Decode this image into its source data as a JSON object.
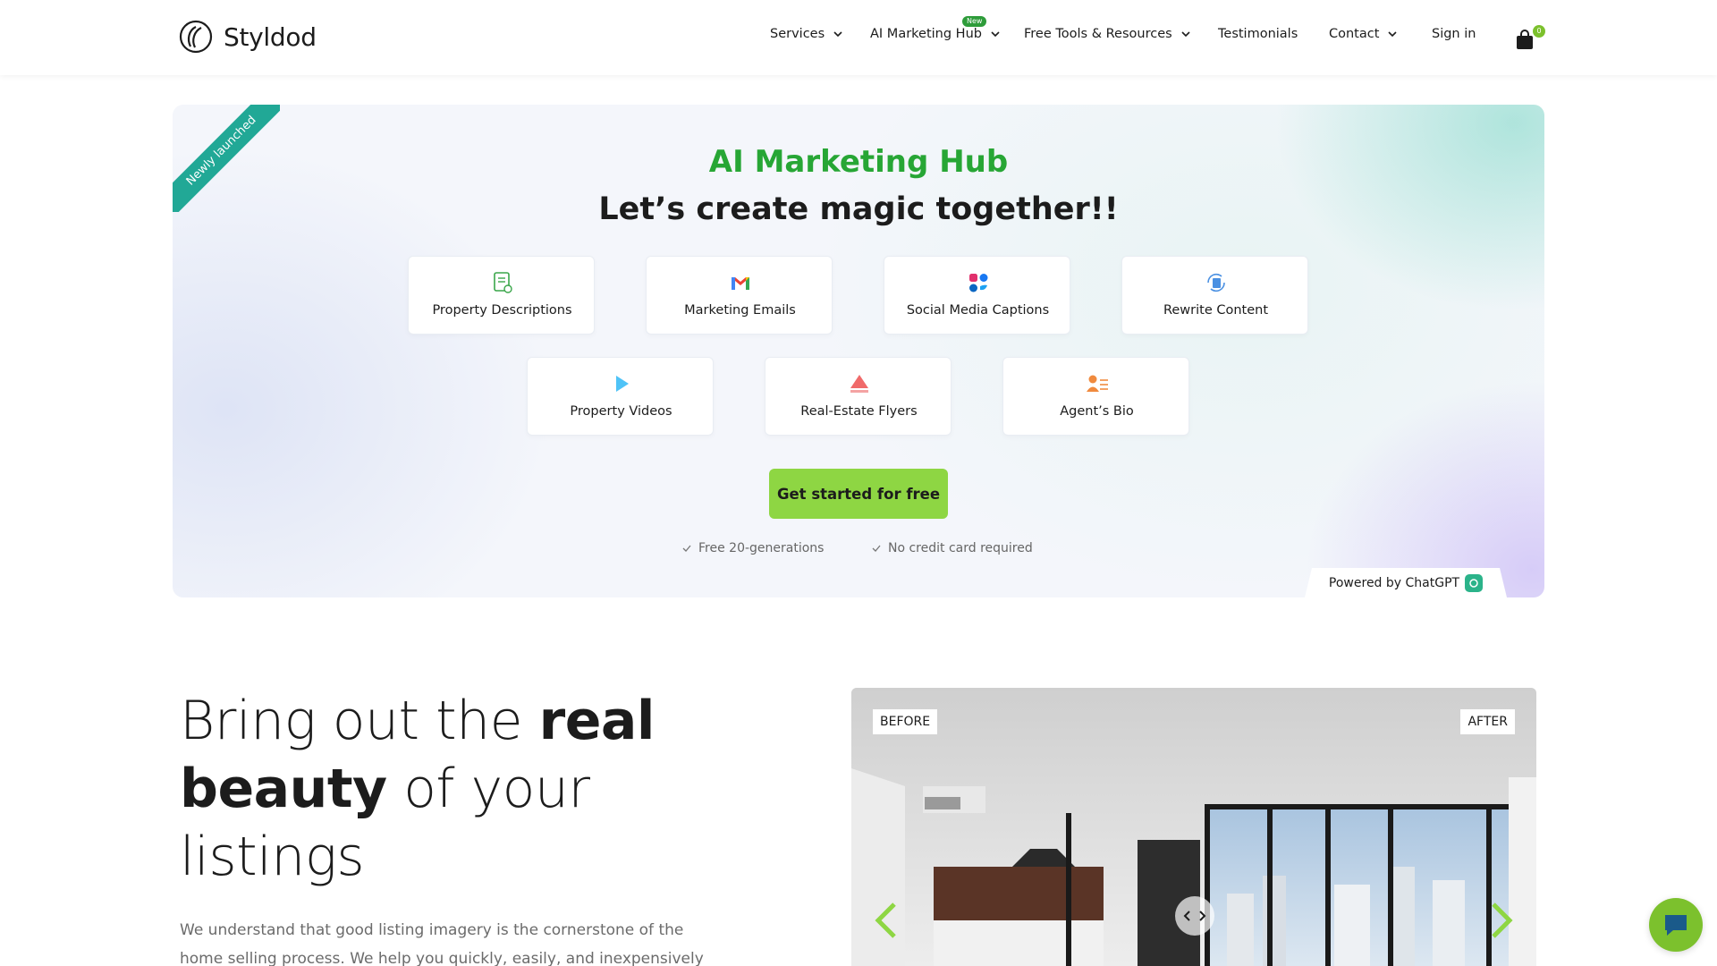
{
  "brand": {
    "name": "Styldod",
    "accent": "#7cc12d",
    "hub_green": "#27a635"
  },
  "nav": {
    "items": [
      {
        "label": "Services",
        "has_dropdown": true
      },
      {
        "label": "AI Marketing Hub",
        "has_dropdown": true,
        "badge": "New"
      },
      {
        "label": "Free Tools & Resources",
        "has_dropdown": true
      },
      {
        "label": "Testimonials",
        "has_dropdown": false
      },
      {
        "label": "Contact",
        "has_dropdown": true
      },
      {
        "label": "Sign in",
        "has_dropdown": false
      }
    ],
    "cart_count": "0"
  },
  "hero": {
    "ribbon": "Newly launched",
    "title": "AI Marketing Hub",
    "subtitle": "Let’s create magic together!!",
    "cards": [
      {
        "label": "Property Descriptions",
        "icon": "document-icon"
      },
      {
        "label": "Marketing Emails",
        "icon": "gmail-icon"
      },
      {
        "label": "Social Media Captions",
        "icon": "social-icons"
      },
      {
        "label": "Rewrite Content",
        "icon": "rewrite-icon"
      },
      {
        "label": "Property Videos",
        "icon": "play-icon"
      },
      {
        "label": "Real-Estate Flyers",
        "icon": "flyer-icon"
      },
      {
        "label": "Agent’s Bio",
        "icon": "agent-icon"
      }
    ],
    "cta": "Get started for free",
    "perks": [
      "Free 20-generations",
      "No credit card required"
    ],
    "powered_by": "Powered by ChatGPT"
  },
  "section": {
    "headline_parts": [
      "Bring out the ",
      "real",
      "beauty",
      " of your",
      "listings"
    ],
    "paragraph": "We understand that good listing imagery is the cornerstone of the home selling process. We help you quickly, easily, and inexpensively edit and",
    "before_label": "BEFORE",
    "after_label": "AFTER"
  }
}
